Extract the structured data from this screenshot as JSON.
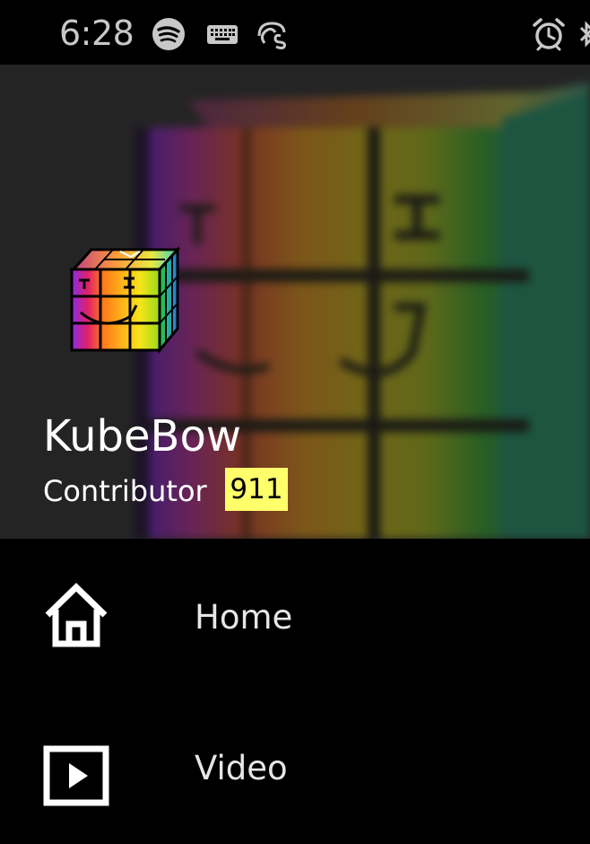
{
  "status_bar": {
    "time": "6:28",
    "icons": [
      "spotify-icon",
      "keyboard-icon",
      "app-logo-icon",
      "alarm-icon"
    ]
  },
  "profile": {
    "username": "KubeBow",
    "role": "Contributor",
    "score": "911",
    "badge_color": "#ffff6b"
  },
  "nav": {
    "items": [
      {
        "label": "Home",
        "icon": "home-icon"
      },
      {
        "label": "Video",
        "icon": "video-icon"
      }
    ]
  }
}
